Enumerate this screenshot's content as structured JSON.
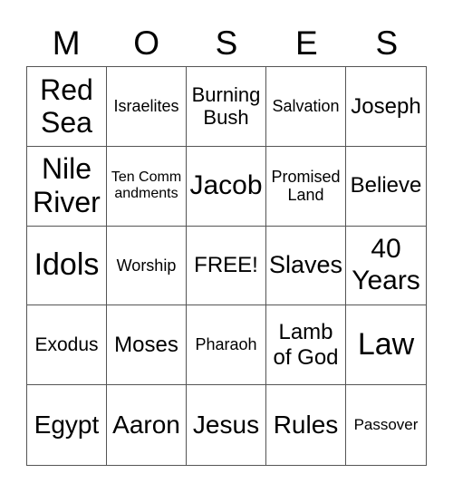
{
  "card": {
    "header_letters": [
      "M",
      "O",
      "S",
      "E",
      "S"
    ],
    "rows": [
      [
        "Red Sea",
        "Israelites",
        "Burning Bush",
        "Salvation",
        "Joseph"
      ],
      [
        "Nile River",
        "Ten Commandments",
        "Jacob",
        "Promised Land",
        "Believe"
      ],
      [
        "Idols",
        "Worship",
        "FREE!",
        "Slaves",
        "40 Years"
      ],
      [
        "Exodus",
        "Moses",
        "Pharaoh",
        "Lamb of God",
        "Law"
      ],
      [
        "Egypt",
        "Aaron",
        "Jesus",
        "Rules",
        "Passover"
      ]
    ],
    "free_space": "FREE!"
  }
}
